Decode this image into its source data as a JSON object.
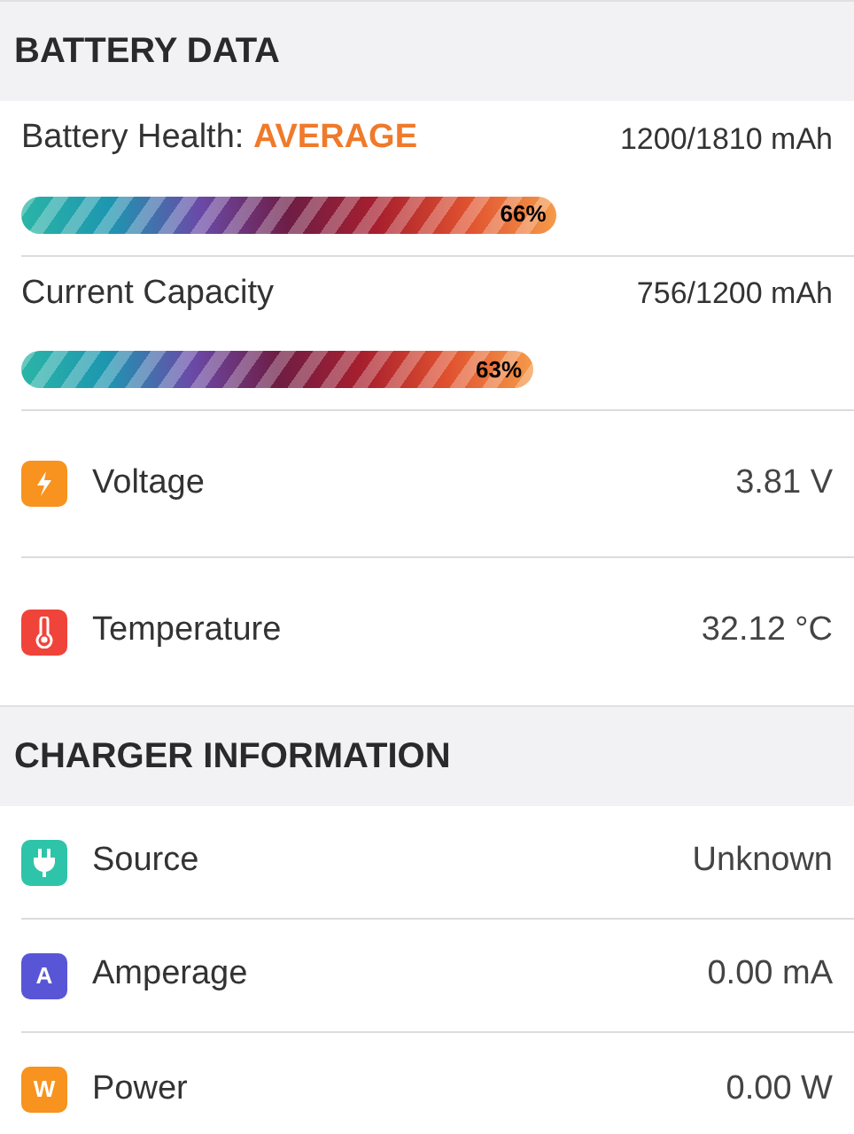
{
  "sections": [
    {
      "title": "BATTERY DATA",
      "rows": [
        {
          "kind": "meter",
          "label": "Battery Health: **AVERAGE**",
          "value": "1200/1810 mAh",
          "level": 0.66,
          "percent": "66%"
        },
        {
          "kind": "meter",
          "label": "Current Capacity",
          "value": "756/1200 mAh",
          "level": 0.63,
          "percent": "63%"
        },
        {
          "kind": "bolt",
          "color": "#f7931e",
          "label": "Voltage",
          "value": "3.81 V"
        },
        {
          "kind": "thermometer",
          "color": "#f0443a",
          "label": "Temperature",
          "value": "32.12 °C"
        }
      ]
    },
    {
      "title": "CHARGER INFORMATION",
      "rows": [
        {
          "kind": "plug",
          "color": "#2ec4a9",
          "label": "Source",
          "value": "Unknown"
        },
        {
          "kind": "letter",
          "glyph": "A",
          "color": "#5856d6",
          "label": "Amperage",
          "value": "0.00 mA"
        },
        {
          "kind": "letter",
          "glyph": "W",
          "color": "#f7931e",
          "label": "Power",
          "value": "0.00 W"
        }
      ]
    }
  ]
}
